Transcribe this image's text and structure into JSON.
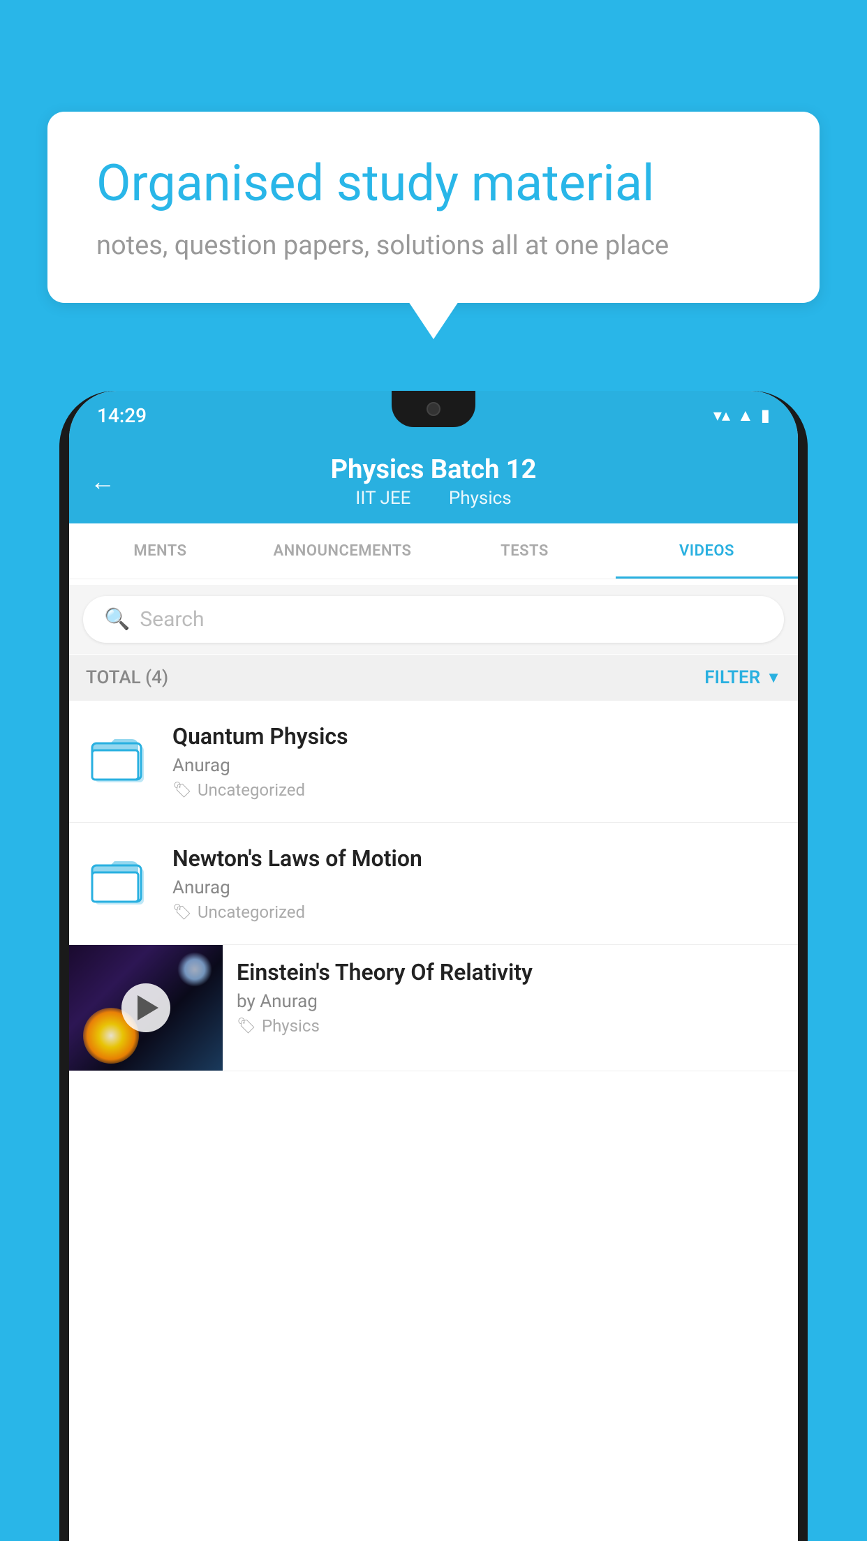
{
  "background_color": "#29b6e8",
  "speech_bubble": {
    "title": "Organised study material",
    "subtitle": "notes, question papers, solutions all at one place"
  },
  "status_bar": {
    "time": "14:29",
    "wifi": "▾",
    "signal": "▾",
    "battery": "▮"
  },
  "header": {
    "title": "Physics Batch 12",
    "subtitle1": "IIT JEE",
    "subtitle2": "Physics",
    "back_label": "←"
  },
  "tabs": [
    {
      "label": "MENTS",
      "active": false
    },
    {
      "label": "ANNOUNCEMENTS",
      "active": false
    },
    {
      "label": "TESTS",
      "active": false
    },
    {
      "label": "VIDEOS",
      "active": true
    }
  ],
  "search": {
    "placeholder": "Search"
  },
  "filter_bar": {
    "total_label": "TOTAL (4)",
    "filter_label": "FILTER"
  },
  "videos": [
    {
      "title": "Quantum Physics",
      "author": "Anurag",
      "tag": "Uncategorized",
      "has_thumb": false
    },
    {
      "title": "Newton's Laws of Motion",
      "author": "Anurag",
      "tag": "Uncategorized",
      "has_thumb": false
    },
    {
      "title": "Einstein's Theory Of Relativity",
      "author": "by Anurag",
      "tag": "Physics",
      "has_thumb": true
    }
  ]
}
